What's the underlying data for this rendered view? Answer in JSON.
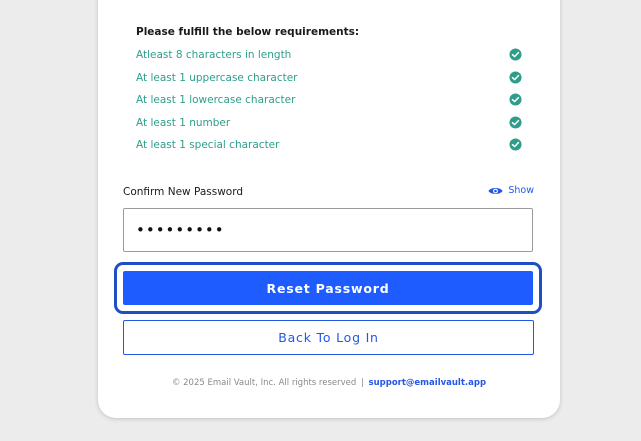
{
  "requirements": {
    "title": "Please fulfill the below requirements:",
    "items": [
      {
        "label": "Atleast 8 characters in length",
        "met": true
      },
      {
        "label": "At least 1 uppercase character",
        "met": true
      },
      {
        "label": "At least 1 lowercase character",
        "met": true
      },
      {
        "label": "At least 1 number",
        "met": true
      },
      {
        "label": "At least 1 special character",
        "met": true
      }
    ]
  },
  "confirm_password": {
    "label": "Confirm New Password",
    "show_label": "Show",
    "value": "•••••••••"
  },
  "buttons": {
    "reset_label": "Reset Password",
    "back_label": "Back To Log In"
  },
  "footer": {
    "copyright": "© 2025 Email Vault, Inc. All rights reserved",
    "separator": "|",
    "support_email": "support@emailvault.app"
  },
  "colors": {
    "accent": "#1f5cff",
    "success": "#2e9e8a",
    "focus_ring": "#1f4fc4"
  },
  "icons": {
    "requirement_met": "check-circle-icon",
    "show_password": "eye-icon"
  }
}
